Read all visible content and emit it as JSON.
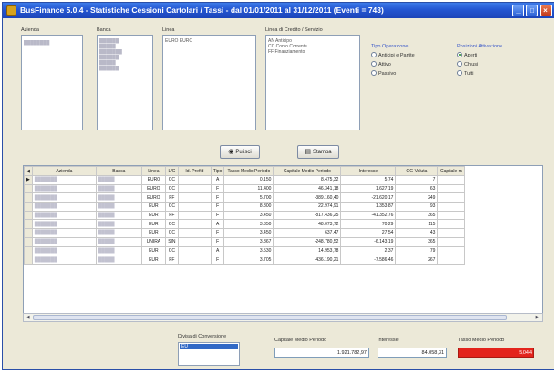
{
  "window": {
    "title": "BusFinance 5.0.4 - Statistiche Cessioni Cartolari / Tassi - dal 01/01/2011 al 31/12/2011 (Eventi = 743)"
  },
  "filters": {
    "azienda_label": "Azienda",
    "banca_label": "Banca",
    "linea_label": "Linea",
    "linea_items": [
      "EURO   EURO"
    ],
    "lineadicredito_label": "Linea di Credito / Servizio",
    "lineadicredito_items": [
      "AN   Anticipo",
      "CC   Conto Corrente",
      "FF   Finanziamento"
    ],
    "tipo_operazione_label": "Tipo Operazione",
    "tipo_options": [
      "Anticipi e Partite",
      "Attivo",
      "Passivo"
    ],
    "stato_label": "Posizioni Attivazione",
    "stato_options": [
      "Aperti",
      "Chiusi",
      "Tutti"
    ],
    "stato_selected": "Aperti"
  },
  "buttons": {
    "stampa_label": "Stampa",
    "pulisci_label": "Pulisci"
  },
  "grid": {
    "columns": [
      "Azienda",
      "Banca",
      "Linea",
      "L/C",
      "Id. Prefid",
      "Tipo",
      "Tasso Medio Periodo",
      "Capitale Medio Periodo",
      "Interesse",
      "GG Valuta",
      "Capitale m"
    ],
    "rows": [
      [
        "EUR0",
        "CC",
        "",
        "A",
        "0.150",
        "8.475,32",
        "5,74",
        "7"
      ],
      [
        "EURO",
        "CC",
        "",
        "F",
        "11.400",
        "46.341,18",
        "1.627,19",
        "63"
      ],
      [
        "EURO",
        "FF",
        "",
        "F",
        "5.700",
        "-389.160,40",
        "-21.620,17",
        "249"
      ],
      [
        "EUR",
        "CC",
        "",
        "F",
        "8.800",
        "22.974,91",
        "1.353,87",
        "93"
      ],
      [
        "EUR",
        "FF",
        "",
        "F",
        "3.450",
        "-817.436,25",
        "-41.352,76",
        "365"
      ],
      [
        "EUR",
        "CC",
        "",
        "A",
        "3.350",
        "48.073,72",
        "70,29",
        "115"
      ],
      [
        "EUR",
        "CC",
        "",
        "F",
        "3.450",
        "637,47",
        "27,54",
        "43"
      ],
      [
        "UNIRA",
        "SIN",
        "",
        "F",
        "3.867",
        "-248.780,52",
        "-6.143,19",
        "365"
      ],
      [
        "EUR",
        "CC",
        "",
        "A",
        "3.530",
        "14.953,78",
        "2,37",
        "79"
      ],
      [
        "EUR",
        "FF",
        "",
        "F",
        "3.705",
        "-436.190,21",
        "-7.586,46",
        "267"
      ]
    ]
  },
  "bottom": {
    "divisa_label": "Divisa di Conversione",
    "divisa_value": "EU",
    "capitale_label": "Capitale Medio Periodo",
    "capitale_value": "1.921.782,97",
    "interesse_label": "Interesse",
    "interesse_value": "84.058,31",
    "tasso_label": "Tasso Medio Periodo",
    "tasso_value": "5,044"
  },
  "colors": {
    "titlebar": "#2456d1",
    "window_bg": "#ece9d8",
    "accent_blue": "#3a58c8",
    "alert_red": "#e3241c"
  }
}
